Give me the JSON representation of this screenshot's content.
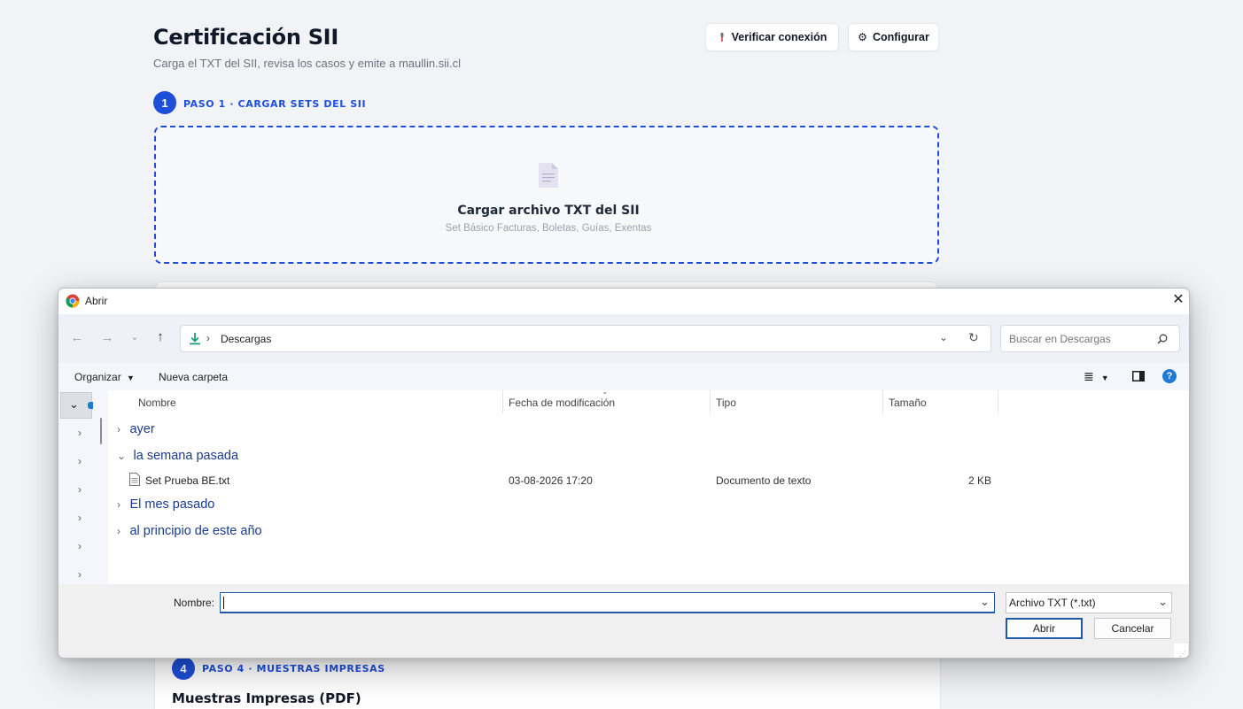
{
  "page": {
    "title": "Certificación SII",
    "subtitle": "Carga el TXT del SII, revisa los casos y emite a maullin.sii.cl",
    "verify_button": "Verificar conexión",
    "config_button": "Configurar",
    "step1": {
      "number": "1",
      "label": "PASO 1 · CARGAR SETS DEL SII"
    },
    "dropzone": {
      "title": "Cargar archivo TXT del SII",
      "subtitle": "Set Básico Facturas, Boletas, Guías, Exentas"
    },
    "step4": {
      "number": "4",
      "label": "PASO 4 · MUESTRAS IMPRESAS"
    },
    "card4_title": "Muestras Impresas (PDF)"
  },
  "dialog": {
    "title": "Abrir",
    "address": {
      "location": "Descargas"
    },
    "search": {
      "placeholder": "Buscar en Descargas"
    },
    "toolbar": {
      "organize": "Organizar",
      "new_folder": "Nueva carpeta"
    },
    "columns": {
      "name": "Nombre",
      "modified": "Fecha de modificación",
      "type": "Tipo",
      "size": "Tamaño"
    },
    "groups": {
      "yesterday": "ayer",
      "last_week": "la semana pasada",
      "last_month": "El mes pasado",
      "early_year": "al principio de este año"
    },
    "file": {
      "name": "Set Prueba BE.txt",
      "modified": "03-08-2026 17:20",
      "type": "Documento de texto",
      "size": "2 KB"
    },
    "footer": {
      "name_label": "Nombre:",
      "name_value": "",
      "filter": "Archivo TXT (*.txt)",
      "open": "Abrir",
      "cancel": "Cancelar"
    }
  },
  "colors": {
    "accent": "#1e4fd8",
    "dialog_link": "#1a3a8f",
    "focus": "#1f5aa6"
  }
}
